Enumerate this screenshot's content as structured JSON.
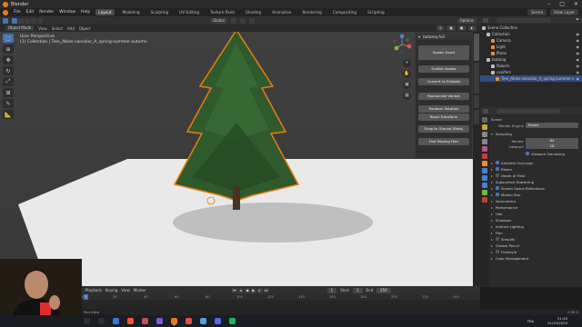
{
  "window": {
    "title": "Blender"
  },
  "menu": {
    "items": [
      "File",
      "Edit",
      "Render",
      "Window",
      "Help"
    ],
    "workspaces": [
      "Layout",
      "Modeling",
      "Sculpting",
      "UV Editing",
      "Texture Paint",
      "Shading",
      "Animation",
      "Rendering",
      "Compositing",
      "Scripting"
    ],
    "active_workspace": "Layout",
    "scene": "Scene",
    "view_layer": "View Layer"
  },
  "viewport_header": {
    "mode": "Object Mode",
    "menus": [
      "View",
      "Select",
      "Add",
      "Object"
    ],
    "orientation": "Global"
  },
  "viewport": {
    "perspective": "User Perspective",
    "collection_path": "(1) Collection | Tree_Abies-concolor_A_spring-summer-autumn",
    "options_label": "Options"
  },
  "botaniq": {
    "title": "botaniq full",
    "buttons": [
      "Spawn Asset",
      "Scatter Assets",
      "Convert to Editable",
      "Randomize Variant",
      "Random Rotation",
      "Reset Transform",
      "Snap to Ground (Beta)",
      "Find Missing Files"
    ]
  },
  "timeline": {
    "menus": [
      "Playback",
      "Keying",
      "View",
      "Marker"
    ],
    "current_frame": "1",
    "start_label": "Start",
    "start": "1",
    "end_label": "End",
    "end": "250",
    "ticks": [
      "0",
      "20",
      "40",
      "60",
      "80",
      "100",
      "120",
      "140",
      "160",
      "180",
      "200",
      "220",
      "240"
    ]
  },
  "statusbar": {
    "left": "Pan View",
    "right": "2.90.0"
  },
  "outliner": {
    "rows": [
      {
        "label": "Scene Collection",
        "indent": 0,
        "color": "#bdbdbd",
        "selected": false
      },
      {
        "label": "Collection",
        "indent": 1,
        "color": "#bdbdbd",
        "selected": false
      },
      {
        "label": "Camera",
        "indent": 2,
        "color": "#e69138",
        "selected": false
      },
      {
        "label": "Light",
        "indent": 2,
        "color": "#e69138",
        "selected": false
      },
      {
        "label": "Plane",
        "indent": 2,
        "color": "#e69138",
        "selected": false
      },
      {
        "label": "botaniq",
        "indent": 1,
        "color": "#bdbdbd",
        "selected": false
      },
      {
        "label": "flowers",
        "indent": 2,
        "color": "#bdbdbd",
        "selected": false
      },
      {
        "label": "conifers",
        "indent": 2,
        "color": "#bdbdbd",
        "selected": false
      },
      {
        "label": "Tree_Abies-concolor_A_spring-summer-a",
        "indent": 3,
        "color": "#e69138",
        "selected": true
      }
    ]
  },
  "properties": {
    "search_placeholder": "",
    "scene_label": "Scene",
    "render_engine_label": "Render Engine",
    "render_engine": "Eevee",
    "sampling": "Sampling",
    "render_label": "Render",
    "render_value": "64",
    "viewport_label": "Viewport",
    "viewport_value": "16",
    "viewport_denoising": "Viewport Denoising",
    "sections": [
      {
        "label": "Ambient Occlusion",
        "checkbox": true
      },
      {
        "label": "Bloom",
        "checkbox": true
      },
      {
        "label": "Depth of Field",
        "checkbox": null
      },
      {
        "label": "Subsurface Scattering",
        "checkbox": null
      },
      {
        "label": "Screen Space Reflections",
        "checkbox": true
      },
      {
        "label": "Motion Blur",
        "checkbox": true
      },
      {
        "label": "Volumetrics",
        "checkbox": null
      },
      {
        "label": "Performance",
        "checkbox": null
      },
      {
        "label": "Hair",
        "checkbox": null
      },
      {
        "label": "Shadows",
        "checkbox": null
      },
      {
        "label": "Indirect Lighting",
        "checkbox": null
      },
      {
        "label": "Film",
        "checkbox": null
      },
      {
        "label": "Simplify",
        "checkbox": true
      },
      {
        "label": "Grease Pencil",
        "checkbox": null
      },
      {
        "label": "Freestyle",
        "checkbox": true
      },
      {
        "label": "Color Management",
        "checkbox": null
      }
    ]
  },
  "taskbar": {
    "language": "FRA",
    "time": "21:40",
    "date": "01/10/2020"
  },
  "colors": {
    "accent": "#4772b3",
    "selection_outline": "#e87d0d",
    "tree": "#2f5a2c"
  }
}
